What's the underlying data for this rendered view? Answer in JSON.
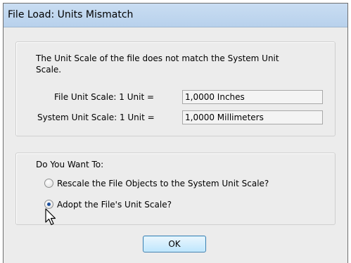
{
  "dialog": {
    "title": "File Load: Units Mismatch"
  },
  "info": {
    "message": "The Unit Scale of the file does not match the System Unit Scale.",
    "file_label": "File Unit Scale: 1 Unit =",
    "file_value": "1,0000 Inches",
    "system_label": "System Unit Scale: 1 Unit =",
    "system_value": "1,0000 Millimeters"
  },
  "options": {
    "legend": "Do You Want To:",
    "rescale_label": "Rescale the File Objects to the System Unit Scale?",
    "adopt_label": "Adopt the File's Unit Scale?",
    "selected": "adopt"
  },
  "buttons": {
    "ok_label": "OK"
  },
  "icons": {
    "cursor": "mouse-pointer-icon"
  }
}
